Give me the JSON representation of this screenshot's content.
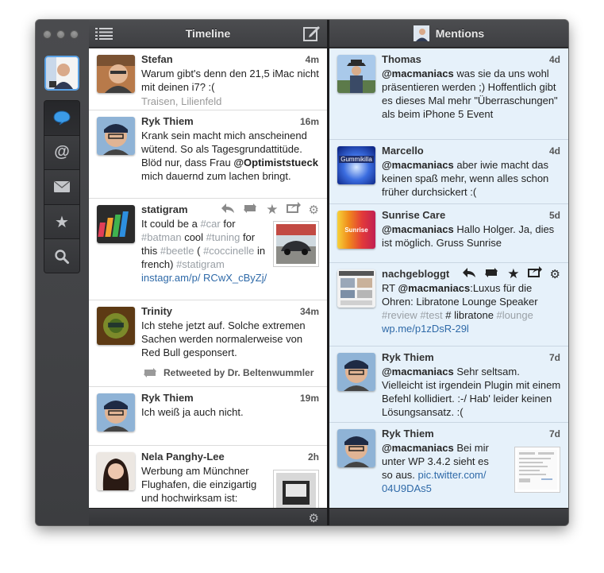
{
  "window": {
    "controls": [
      "close",
      "minimize",
      "zoom"
    ]
  },
  "sidebar": {
    "items": [
      {
        "icon": "speech-bubble-icon",
        "label": "Timeline",
        "active": true
      },
      {
        "icon": "at-sign-icon",
        "label": "Mentions"
      },
      {
        "icon": "envelope-icon",
        "label": "Messages"
      },
      {
        "icon": "star-icon",
        "label": "Favorites"
      },
      {
        "icon": "search-icon",
        "label": "Search"
      }
    ]
  },
  "timeline": {
    "title": "Timeline",
    "tweets": [
      {
        "name": "Stefan",
        "time": "4m",
        "text": "Warum gibt's denn den 21,5 iMac nicht mit deinen i7? :(",
        "location": "Traisen, Lilienfeld"
      },
      {
        "name": "Ryk Thiem",
        "time": "16m",
        "text_a": "Krank sein macht mich anscheinend wütend. So als Tagesgrundattitüde. Blöd nur, dass Frau ",
        "mention": "@Optimiststueck",
        "text_b": " mich dauernd zum lachen bringt."
      },
      {
        "name": "statigram",
        "t1": "It could be a ",
        "h1": "#car",
        "t2": " for ",
        "h2": "#batman",
        "t3": "  cool ",
        "h3": "#tuning",
        "t4": " for this ",
        "h4": "#beetle",
        "t5": " ( ",
        "h5": "#coccinelle",
        "t6": " in french) ",
        "h6": "#statigram",
        "link": "instagr.am/p/ RCwX_cByZj/"
      },
      {
        "name": "Trinity",
        "time": "34m",
        "text": "Ich stehe jetzt auf. Solche extremen Sachen werden normalerweise von Red Bull gesponsert.",
        "retweet": "Retweeted by Dr. Beltenwummler"
      },
      {
        "name": "Ryk Thiem",
        "time": "19m",
        "text": "Ich weiß ja auch nicht."
      },
      {
        "name": "Nela Panghy-Lee",
        "time": "2h",
        "text": "Werbung am Münchner Flughafen, die einzigartig und hochwirksam ist:"
      }
    ]
  },
  "mentions": {
    "title": "Mentions",
    "tweets": [
      {
        "name": "Thomas",
        "time": "4d",
        "mention": "@macmaniacs",
        "text": " was sie da uns wohl präsentieren werden ;) Hoffentlich gibt es dieses Mal mehr \"Überraschungen\" als beim iPhone 5 Event"
      },
      {
        "name": "Marcello",
        "time": "4d",
        "mention": "@macmaniacs",
        "text": " aber iwie macht das keinen spaß mehr, wenn alles schon früher durchsickert :(",
        "avatar_text": "Gummikilla"
      },
      {
        "name": "Sunrise Care",
        "time": "5d",
        "mention": "@macmaniacs",
        "text": " Hallo Holger. Ja, dies ist möglich. Gruss Sunrise",
        "avatar_text": "Sunrise"
      },
      {
        "name": "nachgebloggt",
        "t1": "RT ",
        "mention": "@macmaniacs",
        "t2": ":Luxus für die Ohren: Libratone Lounge Speaker ",
        "h1": "#review",
        "t3": " ",
        "h2": "#test",
        "t4": " # libratone ",
        "h3": "#lounge",
        "link": "wp.me/p1zDsR-29l"
      },
      {
        "name": "Ryk Thiem",
        "time": "7d",
        "mention": "@macmaniacs",
        "text": " Sehr seltsam. Vielleicht ist irgendein Plugin mit einem Befehl kollidiert. :-/ Hab' leider keinen Lösungsansatz. :("
      },
      {
        "name": "Ryk Thiem",
        "time": "7d",
        "mention": "@macmaniacs",
        "t1": " Bei mir unter WP 3.4.2 sieht es so aus. ",
        "link": "pic.twitter.com/ 04U9DAs5"
      }
    ]
  }
}
